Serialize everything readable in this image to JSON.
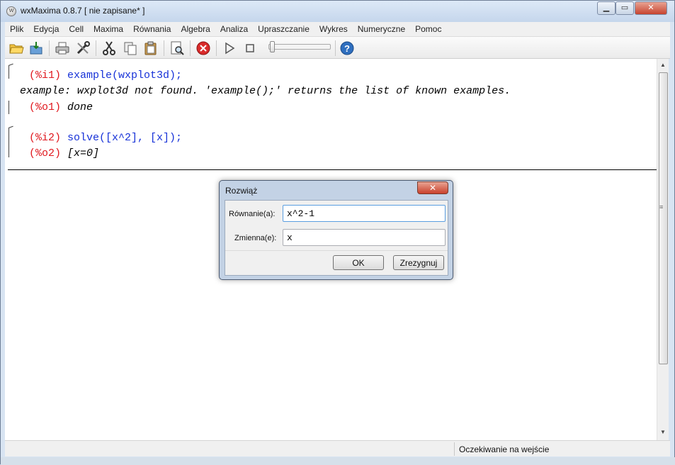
{
  "window": {
    "title": "wxMaxima 0.8.7 [ nie zapisane* ]",
    "app_icon": "W",
    "controls": {
      "minimize": "▁",
      "maximize": "▭",
      "close": "✕"
    }
  },
  "menubar": {
    "items": [
      "Plik",
      "Edycja",
      "Cell",
      "Maxima",
      "Równania",
      "Algebra",
      "Analiza",
      "Upraszczanie",
      "Wykres",
      "Numeryczne",
      "Pomoc"
    ]
  },
  "toolbar": {
    "icons": [
      "open-folder-icon",
      "save-icon",
      "print-icon",
      "preferences-icon",
      "cut-icon",
      "copy-icon",
      "paste-icon",
      "find-icon",
      "interrupt-icon",
      "play-icon",
      "stop-icon",
      "help-icon"
    ]
  },
  "worksheet": {
    "cells": [
      {
        "input_label": "(%i1)",
        "input": "example(wxplot3d);",
        "message": "example: wxplot3d not found. 'example();' returns the list of known examples.",
        "output_label": "(%o1)",
        "output": "done"
      },
      {
        "input_label": "(%i2)",
        "input": "solve([x^2], [x]);",
        "output_label": "(%o2)",
        "output": "[x=0]"
      }
    ]
  },
  "statusbar": {
    "text": "Oczekiwanie na wejście"
  },
  "dialog": {
    "title": "Rozwiąż",
    "close": "✕",
    "equation_label": "Równanie(a):",
    "equation_value": "x^2-1",
    "variable_label": "Zmienna(e):",
    "variable_value": "x",
    "ok_label": "OK",
    "cancel_label": "Zrezygnuj"
  },
  "colors": {
    "input_label": "#e0181e",
    "input_text": "#1631d8",
    "close_red": "#c9412c"
  }
}
